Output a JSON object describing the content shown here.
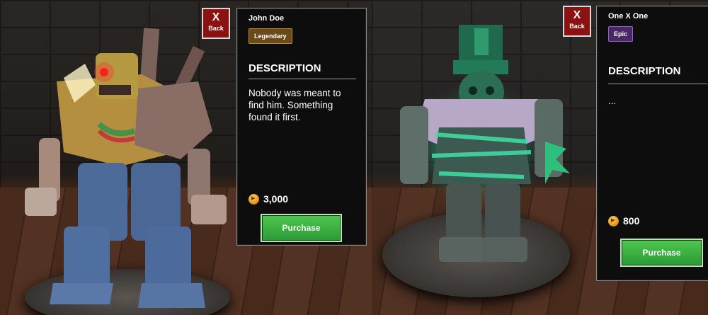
{
  "left": {
    "back": {
      "x": "X",
      "label": "Back"
    },
    "item_name": "John Doe",
    "rarity": "Legendary",
    "description_heading": "DESCRIPTION",
    "description": "Nobody was meant to find him. Something found it first.",
    "price": "3,000",
    "purchase_label": "Purchase"
  },
  "right": {
    "back": {
      "x": "X",
      "label": "Back"
    },
    "item_name": "One X One",
    "rarity": "Epic",
    "description_heading": "DESCRIPTION",
    "description": "...",
    "price": "800",
    "purchase_label": "Purchase"
  },
  "icons": {
    "currency": "coin-icon",
    "close": "close-icon"
  },
  "colors": {
    "purchase": "#2b9a35",
    "back": "#8c1111",
    "legendary": "#c28b33",
    "epic": "#9b5bd0"
  }
}
